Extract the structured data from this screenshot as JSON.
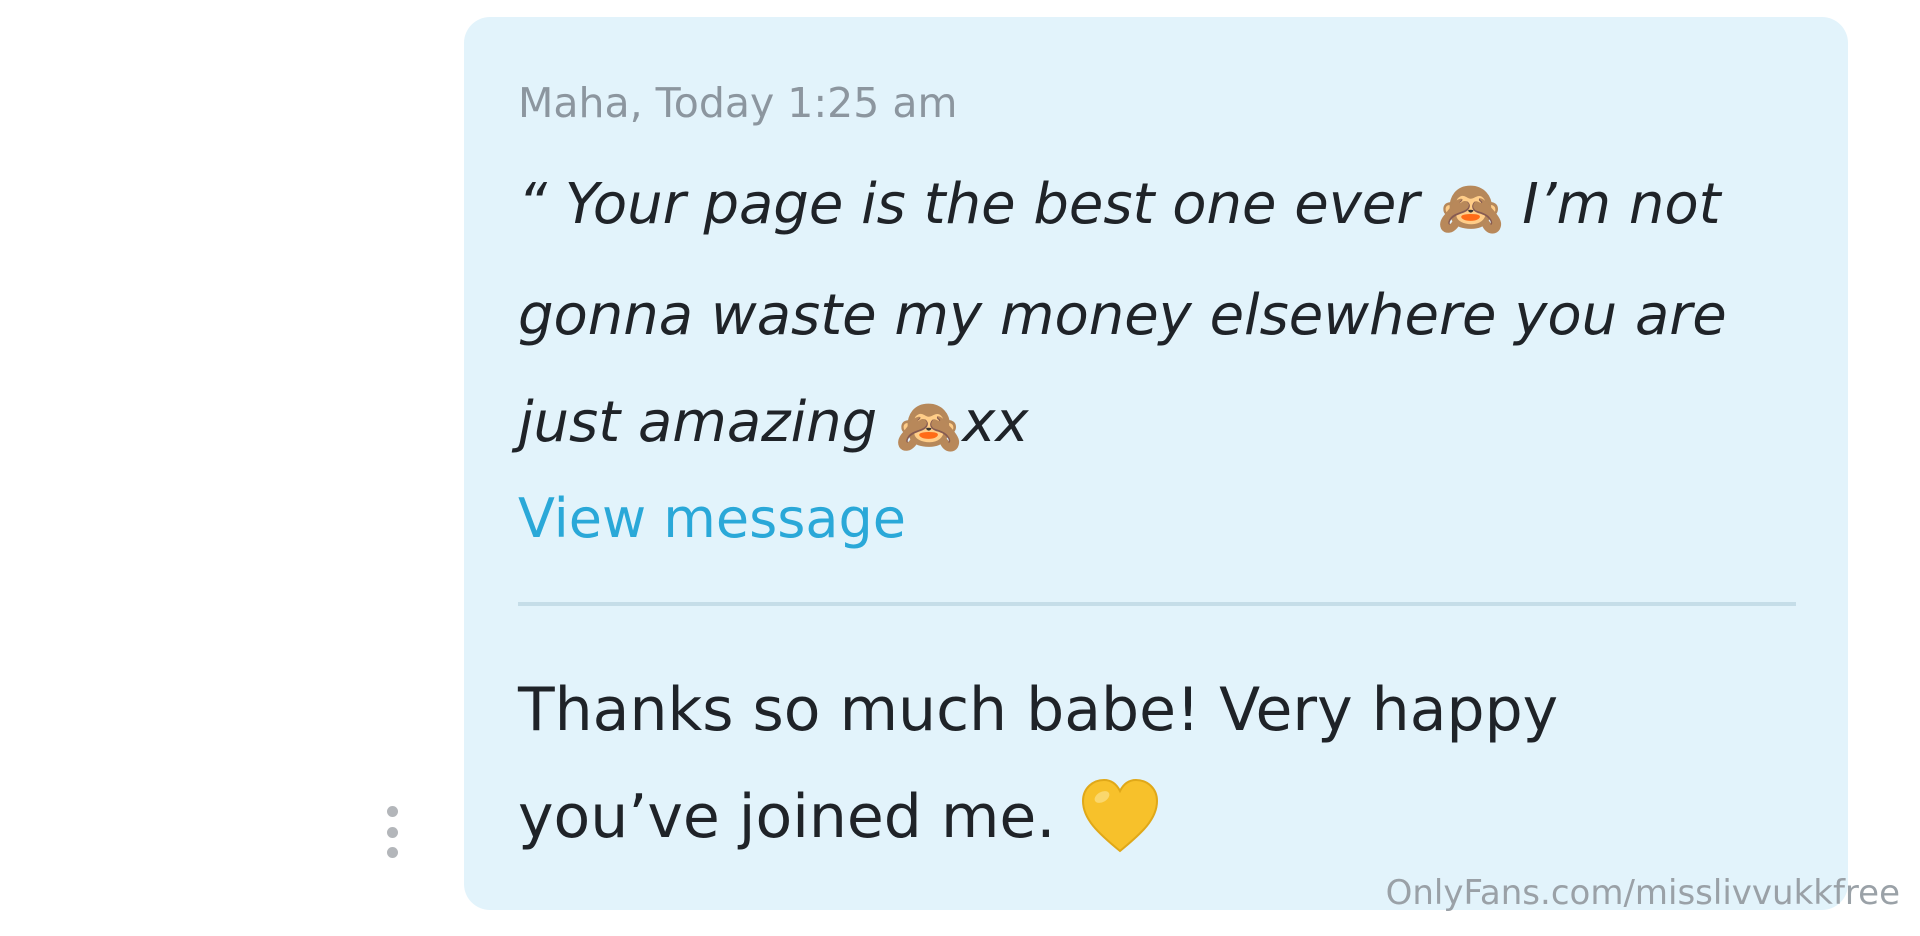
{
  "message": {
    "meta": "Maha, Today 1:25 am",
    "quote_part1": "“ Your page is the best one ever ",
    "quote_part2": " I’m not gonna waste my money elsewhere you are just amazing ",
    "quote_part3": "xx",
    "emoji_monkey": "🙈",
    "view_link": "View message"
  },
  "reply": {
    "text": "Thanks so much babe! Very happy you’ve joined me. ",
    "heart_color": "#f7c12b"
  },
  "watermark": "OnlyFans.com/misslivvukkfree",
  "icons": {
    "more": "more-vertical-icon",
    "monkey": "see-no-evil-monkey-icon",
    "heart": "yellow-heart-icon"
  },
  "colors": {
    "bubble": "#e2f3fb",
    "link": "#2aa8d8",
    "meta": "#8c969f",
    "text": "#1f2328"
  }
}
